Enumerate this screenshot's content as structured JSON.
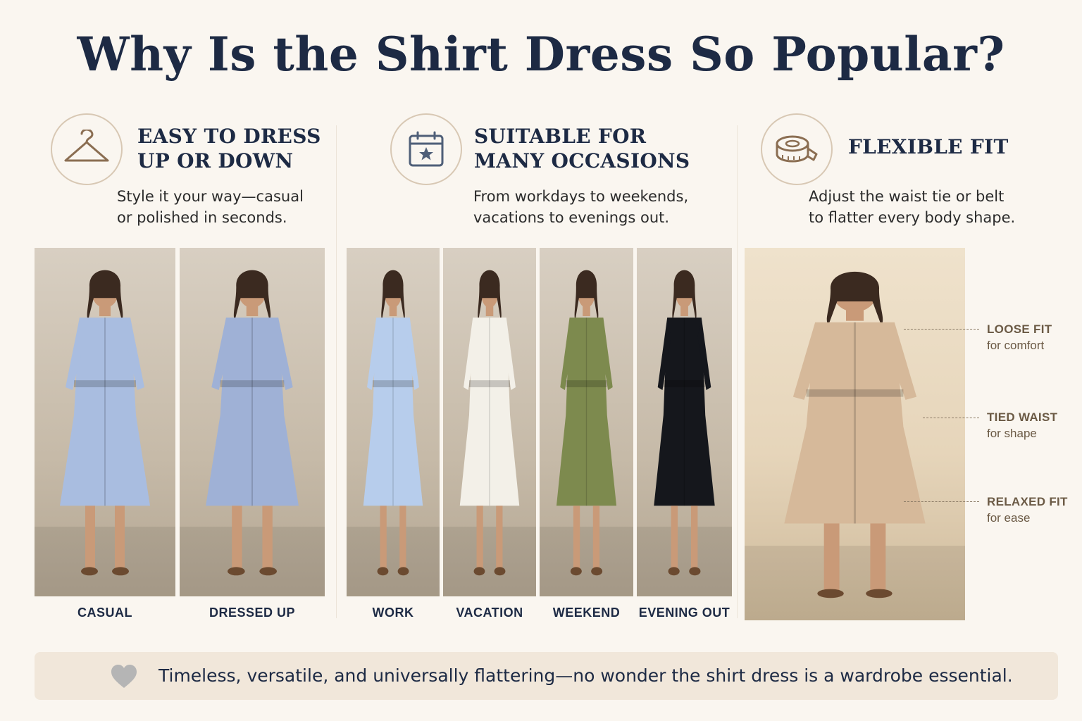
{
  "title": "Why Is the Shirt Dress So Popular?",
  "columns": [
    {
      "icon": "hanger-icon",
      "heading_lines": [
        "EASY TO DRESS",
        "UP OR DOWN"
      ],
      "desc_lines": [
        "Style it your way—casual",
        "or polished in seconds."
      ],
      "photos": [
        {
          "label": "CASUAL",
          "dress_color": "#a9bde0"
        },
        {
          "label": "DRESSED UP",
          "dress_color": "#9fb1d6"
        }
      ]
    },
    {
      "icon": "calendar-star-icon",
      "heading_lines": [
        "SUITABLE FOR",
        "MANY OCCASIONS"
      ],
      "desc_lines": [
        "From workdays to weekends,",
        "vacations to evenings out."
      ],
      "photos": [
        {
          "label": "WORK",
          "dress_color": "#b7cdec"
        },
        {
          "label": "VACATION",
          "dress_color": "#f3f0e8"
        },
        {
          "label": "WEEKEND",
          "dress_color": "#7d8a4e"
        },
        {
          "label": "EVENING OUT",
          "dress_color": "#15171c"
        }
      ]
    },
    {
      "icon": "measuring-tape-icon",
      "heading_lines": [
        "FLEXIBLE FIT"
      ],
      "desc_lines": [
        "Adjust the waist tie or belt",
        "to flatter every body shape."
      ],
      "photo": {
        "dress_color": "#d6b99a"
      },
      "annotations": [
        {
          "title": "LOOSE FIT",
          "sub": "for comfort"
        },
        {
          "title": "TIED WAIST",
          "sub": "for shape"
        },
        {
          "title": "RELAXED FIT",
          "sub": "for ease"
        }
      ]
    }
  ],
  "footer": {
    "icon": "heart-icon",
    "text": "Timeless, versatile, and universally flattering—no wonder the shirt dress is a wardrobe essential."
  },
  "colors": {
    "background": "#faf6f0",
    "navy": "#1d2a44",
    "icon_brown": "#8b6e52",
    "footer_bg": "#f1e7da",
    "heart_gray": "#b5b5b5"
  }
}
